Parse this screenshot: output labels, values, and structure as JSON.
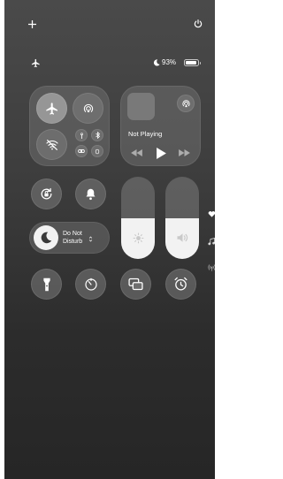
{
  "topbar": {
    "plus_icon": "plus-icon",
    "power_icon": "power-icon"
  },
  "status": {
    "airplane_icon": "airplane-icon",
    "moon_icon": "moon-icon",
    "battery_text": "93%",
    "battery_level": 0.93
  },
  "media": {
    "title": "Not Playing"
  },
  "focus": {
    "label_line1": "Do Not",
    "label_line2": "Disturb"
  },
  "sliders": {
    "brightness_level": 0.5,
    "volume_level": 0.5
  },
  "side": {
    "heart_icon": "heart-icon",
    "music_icon": "music-note-icon",
    "signal_icon": "signal-icon"
  }
}
